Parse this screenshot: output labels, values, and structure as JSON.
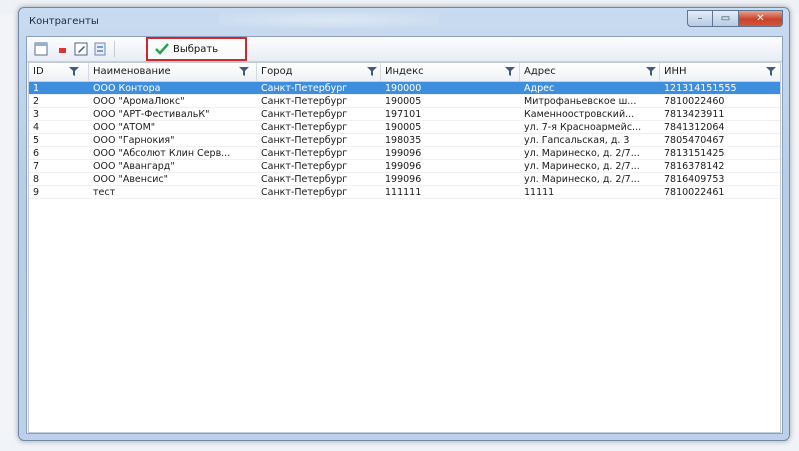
{
  "window": {
    "title": "Контрагенты",
    "close_glyph": "✕",
    "minimize_glyph": "–",
    "maximize_glyph": "▭"
  },
  "toolbar": {
    "select_label": "Выбрать",
    "icons": [
      "new-document-icon",
      "delete-icon",
      "edit-icon",
      "refresh-icon",
      "checkmark-icon"
    ]
  },
  "colors": {
    "selection": "#3e8ede",
    "highlight_border": "#d6262d",
    "check_green": "#2aa34a"
  },
  "grid": {
    "columns": [
      {
        "key": "id",
        "label": "ID"
      },
      {
        "key": "name",
        "label": "Наименование"
      },
      {
        "key": "city",
        "label": "Город"
      },
      {
        "key": "index",
        "label": "Индекс"
      },
      {
        "key": "address",
        "label": "Адрес"
      },
      {
        "key": "inn",
        "label": "ИНН"
      }
    ],
    "selected_row": 0,
    "rows": [
      {
        "id": "1",
        "name": "ООО Контора",
        "city": "Санкт-Петербург",
        "index": "190000",
        "address": "Адрес",
        "inn": "121314151555"
      },
      {
        "id": "2",
        "name": "ООО \"АромаЛюкс\"",
        "city": "Санкт-Петербург",
        "index": "190005",
        "address": "Митрофаньевское ш...",
        "inn": "7810022460"
      },
      {
        "id": "3",
        "name": "ООО \"АРТ-ФестивальК\"",
        "city": "Санкт-Петербург",
        "index": "197101",
        "address": "Каменноостровский...",
        "inn": "7813423911"
      },
      {
        "id": "4",
        "name": "ООО \"АТОМ\"",
        "city": "Санкт-Петербург",
        "index": "190005",
        "address": "ул. 7-я Красноармейс...",
        "inn": "7841312064"
      },
      {
        "id": "5",
        "name": "ООО \"Гарнокия\"",
        "city": "Санкт-Петербург",
        "index": "198035",
        "address": "ул. Гапсальская, д. 3",
        "inn": "7805470467"
      },
      {
        "id": "6",
        "name": "ООО \"Абсолют Клин Серв...",
        "city": "Санкт-Петербург",
        "index": "199096",
        "address": "ул. Маринеско, д. 2/7...",
        "inn": "7813151425"
      },
      {
        "id": "7",
        "name": "ООО \"Авангард\"",
        "city": "Санкт-Петербург",
        "index": "199096",
        "address": "ул. Маринеско, д. 2/7...",
        "inn": "7816378142"
      },
      {
        "id": "8",
        "name": "ООО \"Авенсис\"",
        "city": "Санкт-Петербург",
        "index": "199096",
        "address": "ул. Маринеско, д. 2/7...",
        "inn": "7816409753"
      },
      {
        "id": "9",
        "name": "тест",
        "city": "Санкт-Петербург",
        "index": "111111",
        "address": "11111",
        "inn": "7810022461"
      }
    ]
  }
}
